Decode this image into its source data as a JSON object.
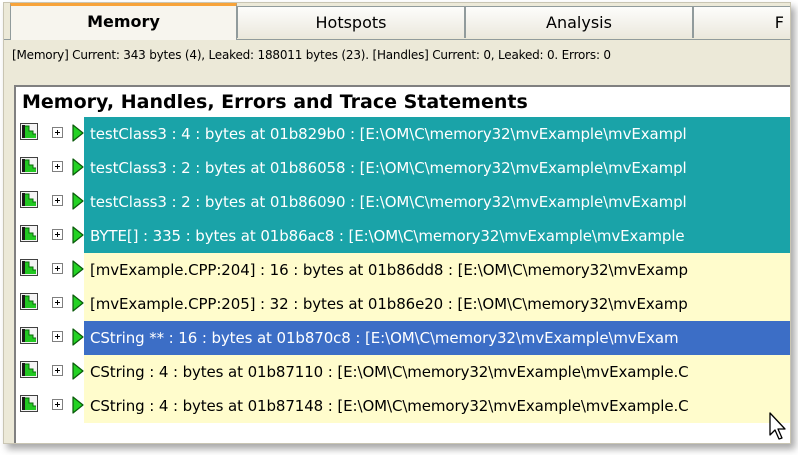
{
  "tabs": [
    {
      "label": "Memory",
      "active": true
    },
    {
      "label": "Hotspots",
      "active": false
    },
    {
      "label": "Analysis",
      "active": false
    },
    {
      "label": "F",
      "active": false
    }
  ],
  "status_line": "[Memory] Current: 343 bytes (4), Leaked: 188011 bytes (23). [Handles] Current: 0, Leaked: 0. Errors: 0",
  "panel": {
    "title": "Memory, Handles, Errors and Trace Statements",
    "rows": [
      {
        "text": "testClass3 : 4 : bytes at 01b829b0 : [E:\\OM\\C\\memory32\\mvExample\\mvExampl",
        "style": "teal"
      },
      {
        "text": "testClass3 : 2 : bytes at 01b86058 : [E:\\OM\\C\\memory32\\mvExample\\mvExampl",
        "style": "teal"
      },
      {
        "text": "testClass3 : 2 : bytes at 01b86090 : [E:\\OM\\C\\memory32\\mvExample\\mvExampl",
        "style": "teal"
      },
      {
        "text": "BYTE[] : 335 : bytes at 01b86ac8 : [E:\\OM\\C\\memory32\\mvExample\\mvExample",
        "style": "teal"
      },
      {
        "text": "[mvExample.CPP:204] : 16 : bytes at 01b86dd8 : [E:\\OM\\C\\memory32\\mvExamp",
        "style": "yellow"
      },
      {
        "text": "[mvExample.CPP:205] : 32 : bytes at 01b86e20 : [E:\\OM\\C\\memory32\\mvExamp",
        "style": "yellow"
      },
      {
        "text": "CString ** : 16 : bytes at 01b870c8 : [E:\\OM\\C\\memory32\\mvExample\\mvExam",
        "style": "sel"
      },
      {
        "text": "CString : 4 : bytes at 01b87110 : [E:\\OM\\C\\memory32\\mvExample\\mvExample.C",
        "style": "yellow"
      },
      {
        "text": "CString : 4 : bytes at 01b87148 : [E:\\OM\\C\\memory32\\mvExample\\mvExample.C",
        "style": "yellow"
      }
    ]
  },
  "icons": {
    "row_flag": "leak-flag-icon",
    "row_expand": "plus-box-icon",
    "row_play": "green-triangle-icon",
    "pointer": "mouse-cursor-icon"
  },
  "colors": {
    "teal_row": "#1aa3a8",
    "yellow_row": "#fffccc",
    "selected_row": "#3c6ec6",
    "active_tab_accent": "#f7a33a"
  }
}
